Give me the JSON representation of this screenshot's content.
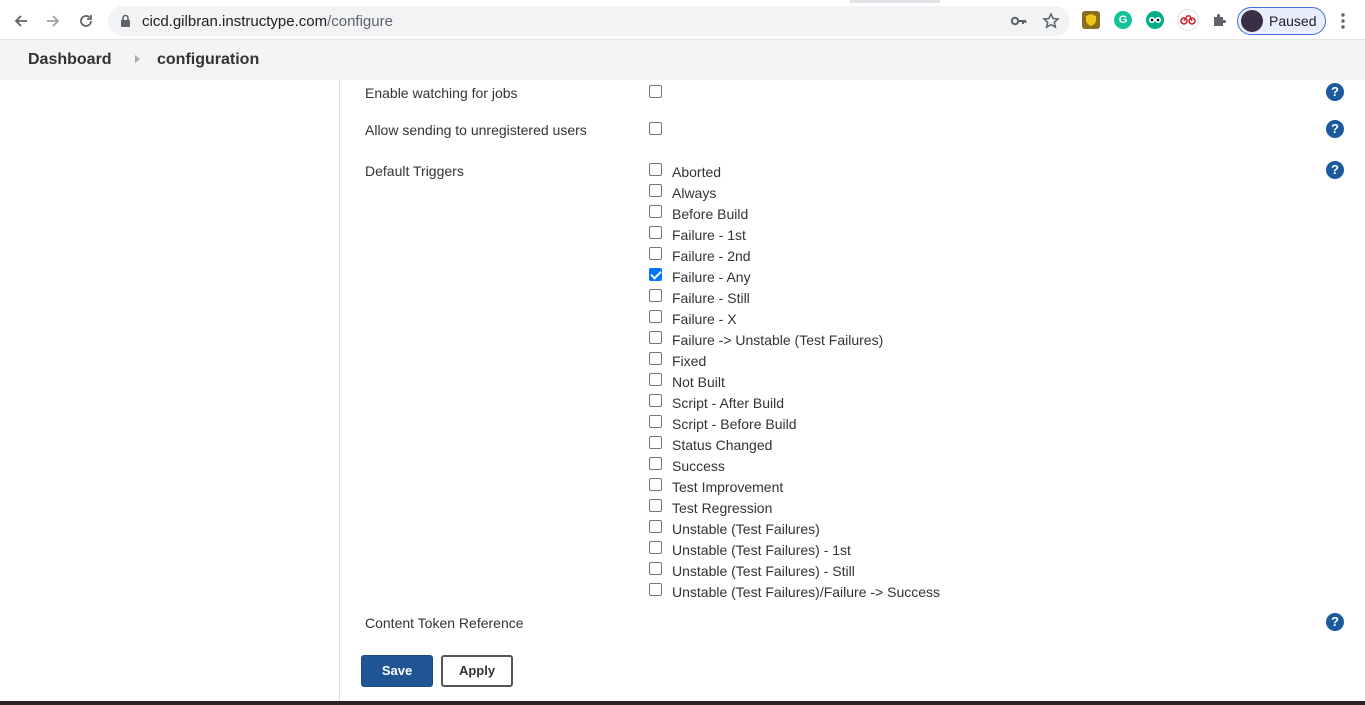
{
  "browser": {
    "url_host": "cicd.gilbran.instructype.com",
    "url_path": "/configure",
    "profile_label": "Paused"
  },
  "breadcrumb": {
    "items": [
      "Dashboard",
      "configuration"
    ]
  },
  "form": {
    "watching_label": "Enable watching for jobs",
    "unregistered_label": "Allow sending to unregistered users",
    "triggers_label": "Default Triggers",
    "triggers": [
      {
        "label": "Aborted",
        "checked": false
      },
      {
        "label": "Always",
        "checked": false
      },
      {
        "label": "Before Build",
        "checked": false
      },
      {
        "label": "Failure - 1st",
        "checked": false
      },
      {
        "label": "Failure - 2nd",
        "checked": false
      },
      {
        "label": "Failure - Any",
        "checked": true
      },
      {
        "label": "Failure - Still",
        "checked": false
      },
      {
        "label": "Failure - X",
        "checked": false
      },
      {
        "label": "Failure -> Unstable (Test Failures)",
        "checked": false
      },
      {
        "label": "Fixed",
        "checked": false
      },
      {
        "label": "Not Built",
        "checked": false
      },
      {
        "label": "Script - After Build",
        "checked": false
      },
      {
        "label": "Script - Before Build",
        "checked": false
      },
      {
        "label": "Status Changed",
        "checked": false
      },
      {
        "label": "Success",
        "checked": false
      },
      {
        "label": "Test Improvement",
        "checked": false
      },
      {
        "label": "Test Regression",
        "checked": false
      },
      {
        "label": "Unstable (Test Failures)",
        "checked": false
      },
      {
        "label": "Unstable (Test Failures) - 1st",
        "checked": false
      },
      {
        "label": "Unstable (Test Failures) - Still",
        "checked": false
      },
      {
        "label": "Unstable (Test Failures)/Failure -> Success",
        "checked": false
      }
    ],
    "content_token_label": "Content Token Reference",
    "help_glyph": "?"
  },
  "buttons": {
    "save": "Save",
    "apply": "Apply"
  },
  "colors": {
    "save_bg": "#1f5592",
    "help_bg": "#1b5a9c",
    "checkbox_checked": "#0075ff"
  }
}
